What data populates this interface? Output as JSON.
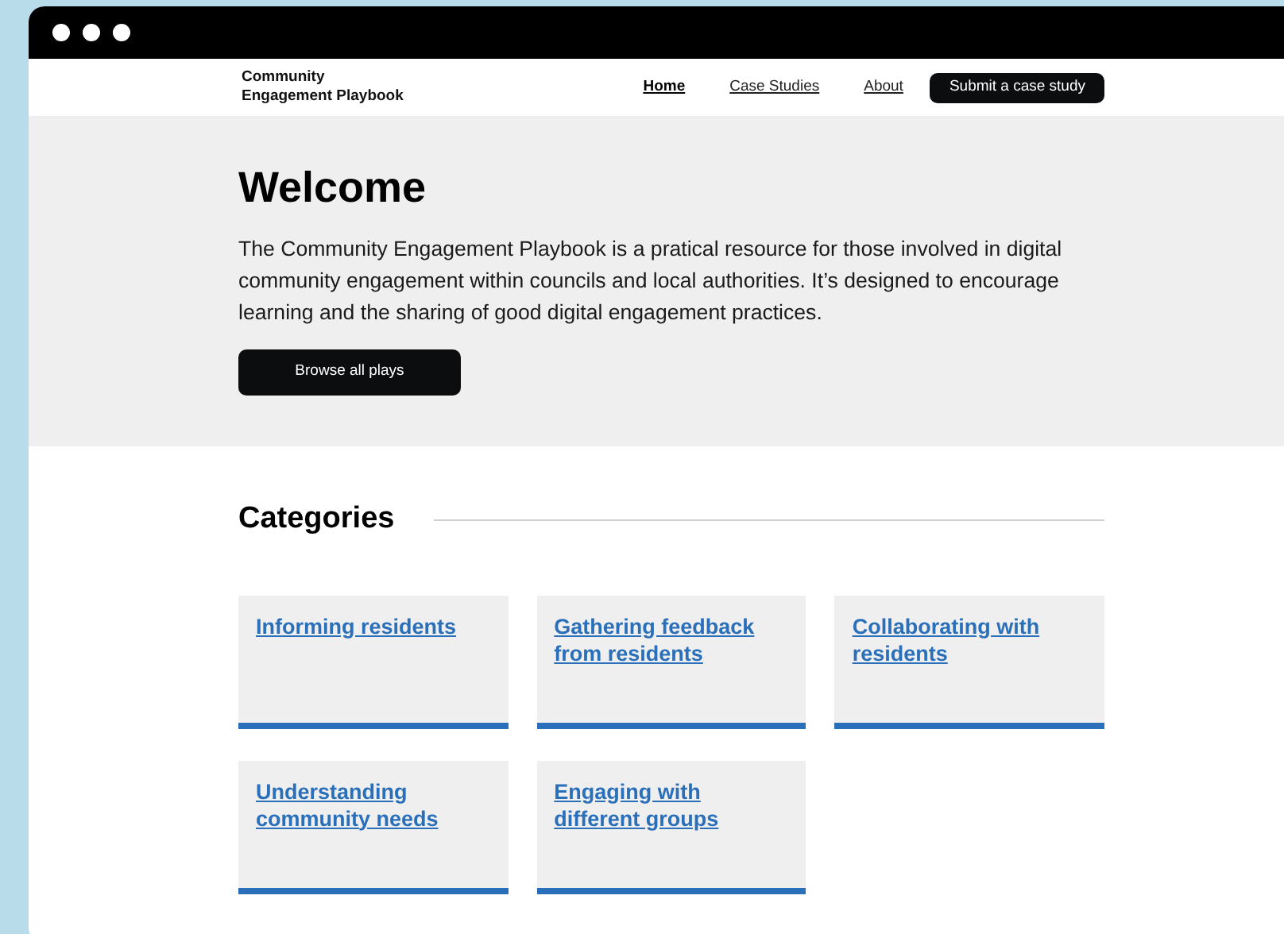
{
  "site_title": "Community Engagement Playbook",
  "nav": [
    {
      "label": "Home",
      "selected": true
    },
    {
      "label": "Case Studies",
      "selected": false
    },
    {
      "label": "About",
      "selected": false
    }
  ],
  "nav_button": "Submit a case study",
  "hero": {
    "title": "Welcome",
    "text": "The Community Engagement Playbook is a pratical resource for those involved in digital community engagement within councils and local authorities. It’s designed to encourage learning and the sharing of good digital engagement practices.",
    "button": "Browse all plays"
  },
  "categories": {
    "title": "Categories",
    "items": [
      {
        "label": "Informing residents"
      },
      {
        "label": "Gathering feedback from residents"
      },
      {
        "label": "Collaborating with residents"
      },
      {
        "label": "Understanding community needs"
      },
      {
        "label": "Engaging with different groups"
      }
    ]
  }
}
